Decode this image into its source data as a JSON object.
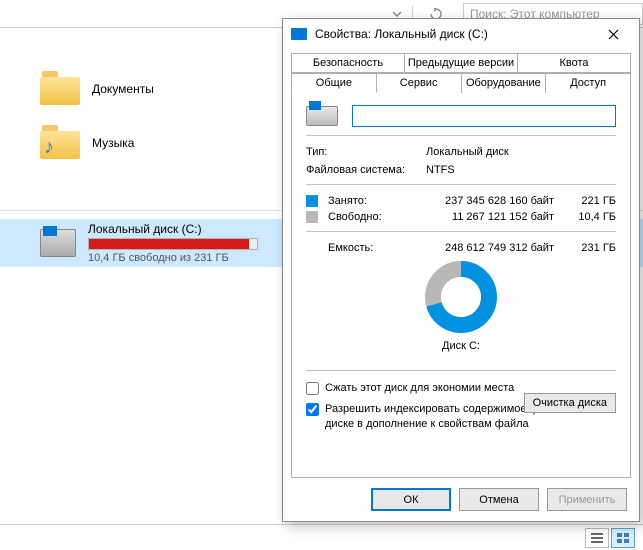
{
  "explorer": {
    "search_placeholder": "Поиск: Этот компьютер",
    "folders": [
      {
        "label": "Документы",
        "overlay": "📄"
      },
      {
        "label": "Музыка",
        "overlay": "♪"
      }
    ],
    "drive": {
      "title": "Локальный диск (C:)",
      "subtitle": "10,4 ГБ свободно из 231 ГБ"
    }
  },
  "dialog": {
    "title": "Свойства: Локальный диск (C:)",
    "tabs_back": [
      "Безопасность",
      "Предыдущие версии",
      "Квота"
    ],
    "tabs_front": [
      "Общие",
      "Сервис",
      "Оборудование",
      "Доступ"
    ],
    "name_value": "",
    "type_label": "Тип:",
    "type_value": "Локальный диск",
    "fs_label": "Файловая система:",
    "fs_value": "NTFS",
    "used_label": "Занято:",
    "used_bytes": "237 345 628 160 байт",
    "used_gb": "221 ГБ",
    "free_label": "Свободно:",
    "free_bytes": "11 267 121 152 байт",
    "free_gb": "10,4 ГБ",
    "cap_label": "Емкость:",
    "cap_bytes": "248 612 749 312 байт",
    "cap_gb": "231 ГБ",
    "disk_caption": "Диск C:",
    "cleanup": "Очистка диска",
    "compress": "Сжать этот диск для экономии места",
    "index": "Разрешить индексировать содержимое файлов на этом диске в дополнение к свойствам файла",
    "ok": "ОК",
    "cancel": "Отмена",
    "apply": "Применить"
  },
  "chart_data": {
    "type": "pie",
    "title": "Диск C:",
    "series": [
      {
        "name": "Занято",
        "value": 237345628160,
        "color": "#0092e0"
      },
      {
        "name": "Свободно",
        "value": 11267121152,
        "color": "#b8b8b8"
      }
    ]
  }
}
